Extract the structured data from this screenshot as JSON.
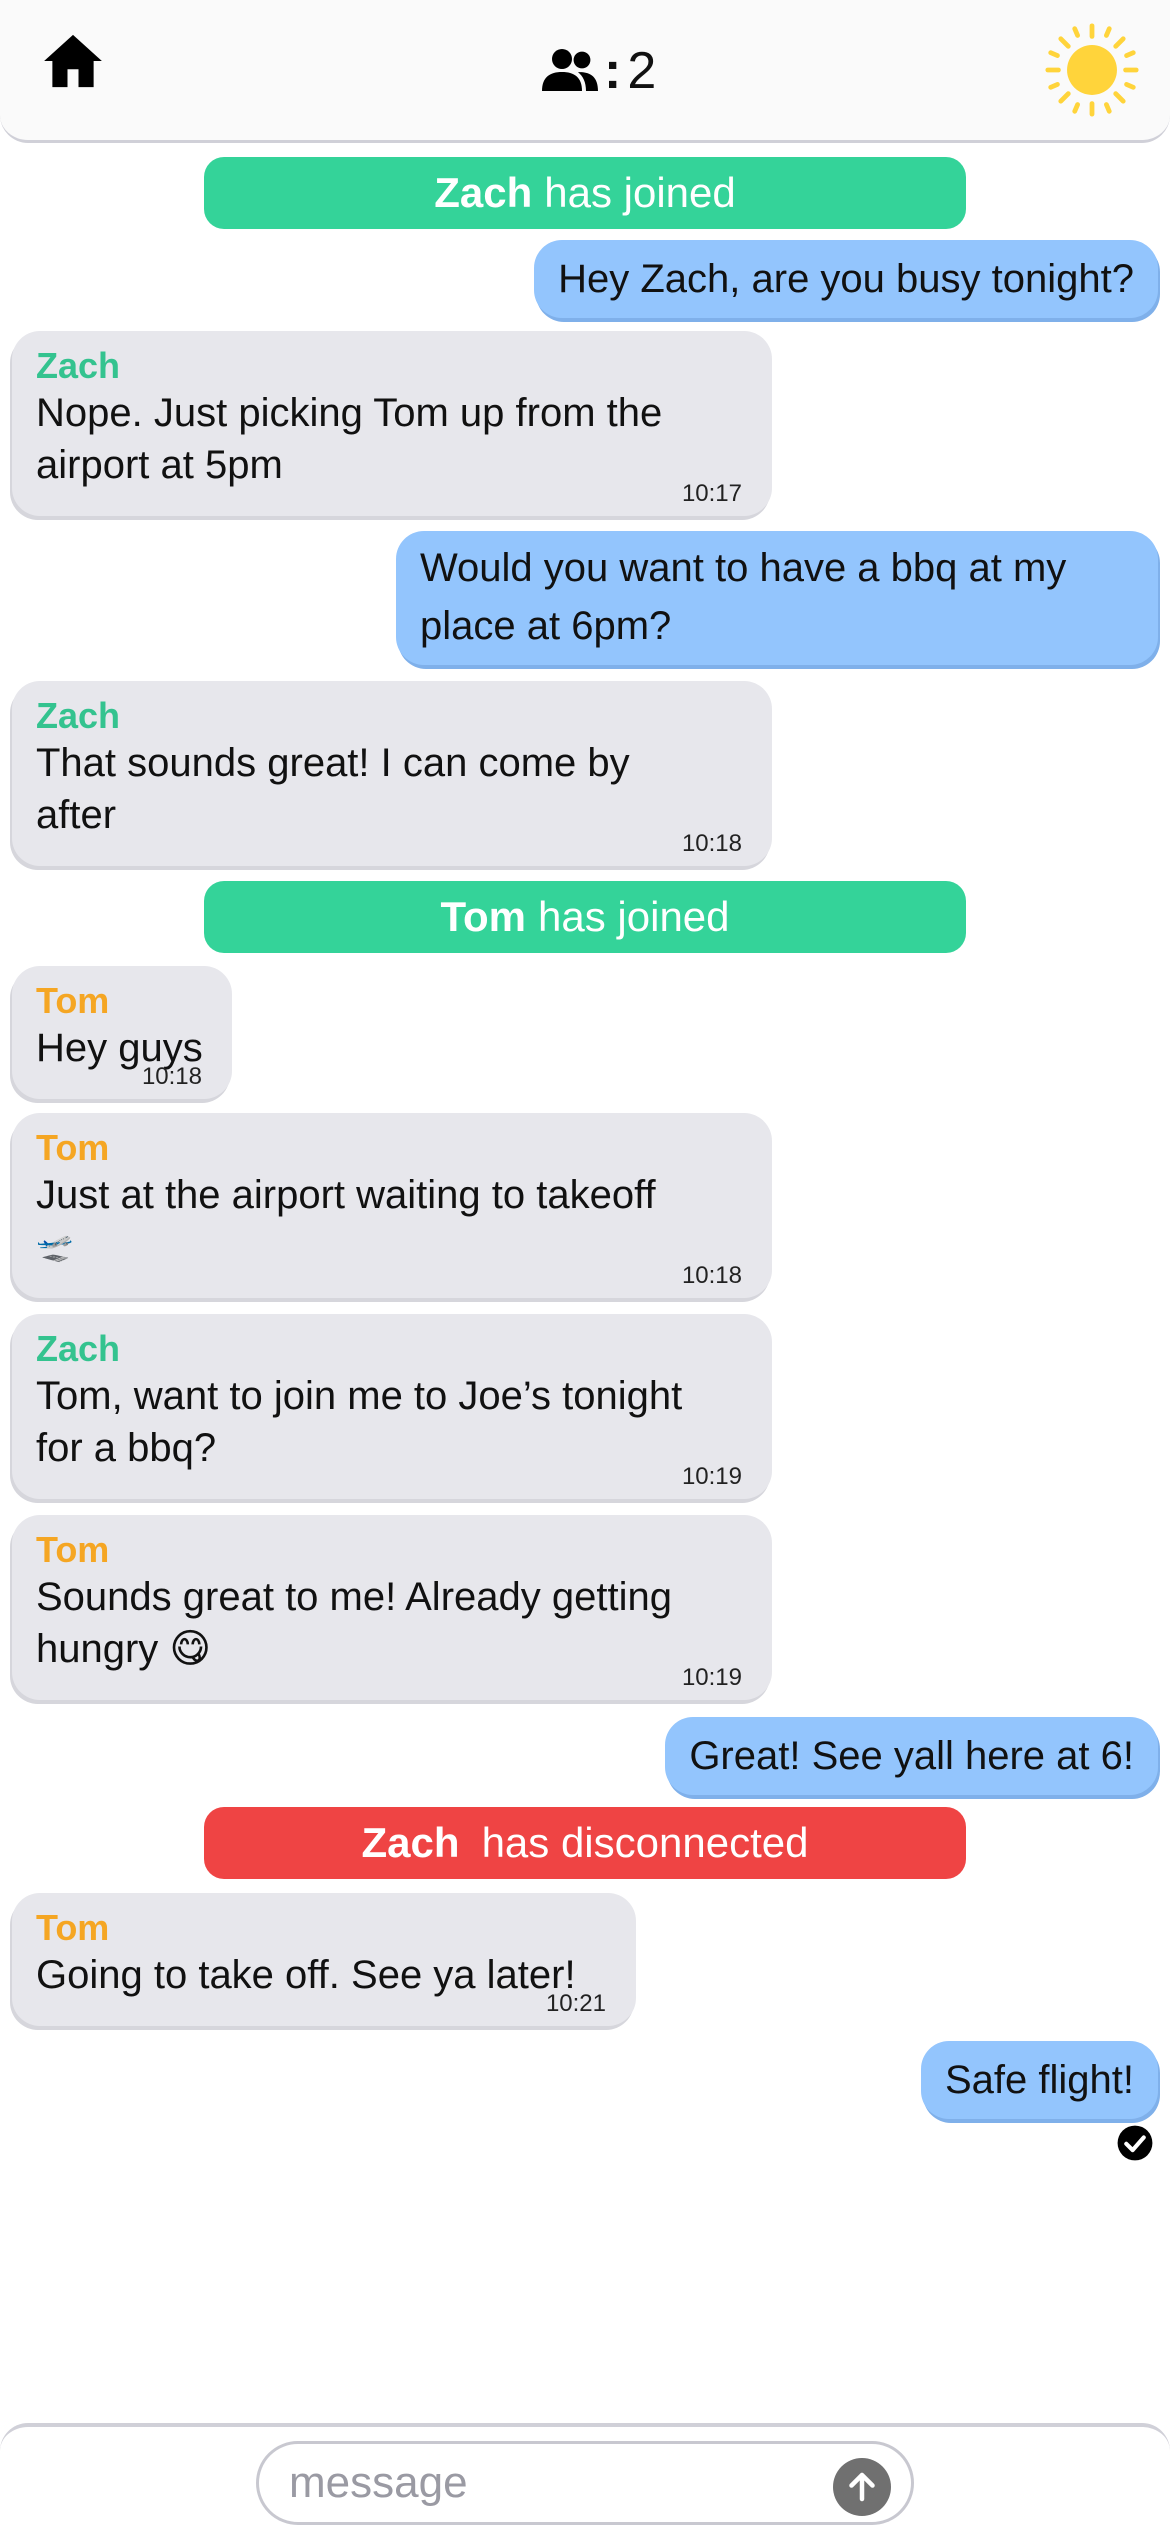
{
  "header": {
    "home_icon": "home-icon",
    "users_icon": "users-icon",
    "users_colon": ":",
    "users_count": "2",
    "theme_icon": "sun-icon",
    "sun_color": "#ffd43b"
  },
  "colors": {
    "incoming_bubble": "#e7e7ec",
    "outgoing_bubble": "#93c5fd",
    "join_banner": "#34d399",
    "leave_banner": "#ef4444",
    "zach_name": "#34c38f",
    "tom_name": "#f5a623"
  },
  "messages": [
    {
      "type": "system",
      "event": "join",
      "name": "Zach",
      "text": "has joined"
    },
    {
      "type": "outgoing",
      "text": "Hey Zach, are you busy tonight?"
    },
    {
      "type": "incoming",
      "sender": "Zach",
      "line1": "Nope. Just picking Tom up from the",
      "line2": "airport at 5pm",
      "time": "10:17"
    },
    {
      "type": "outgoing",
      "line1": "Would you want to have a bbq at my",
      "line2": "place at 6pm?"
    },
    {
      "type": "incoming",
      "sender": "Zach",
      "line1": "That sounds great! I can come by",
      "line2": "after",
      "time": "10:18"
    },
    {
      "type": "system",
      "event": "join",
      "name": "Tom",
      "text": "has joined"
    },
    {
      "type": "incoming",
      "sender": "Tom",
      "text": "Hey guys",
      "time": "10:18"
    },
    {
      "type": "incoming",
      "sender": "Tom",
      "line1": "Just at the airport waiting to takeoff",
      "line2": "🛫",
      "time": "10:18"
    },
    {
      "type": "incoming",
      "sender": "Zach",
      "line1": "Tom, want to join me to Joe’s tonight",
      "line2": "for a bbq?",
      "time": "10:19"
    },
    {
      "type": "incoming",
      "sender": "Tom",
      "line1": "Sounds great to me! Already getting",
      "line2": "hungry 😋",
      "time": "10:19"
    },
    {
      "type": "outgoing",
      "text": "Great! See yall here at 6!"
    },
    {
      "type": "system",
      "event": "disconnect",
      "name": "Zach",
      "text": "has disconnected"
    },
    {
      "type": "incoming",
      "sender": "Tom",
      "text": "Going to take off. See ya later!",
      "time": "10:21"
    },
    {
      "type": "outgoing",
      "text": "Safe flight!",
      "status_icon": "read-check-icon"
    }
  ],
  "composer": {
    "placeholder": "message",
    "value": "",
    "send_icon": "arrow-up-icon"
  }
}
